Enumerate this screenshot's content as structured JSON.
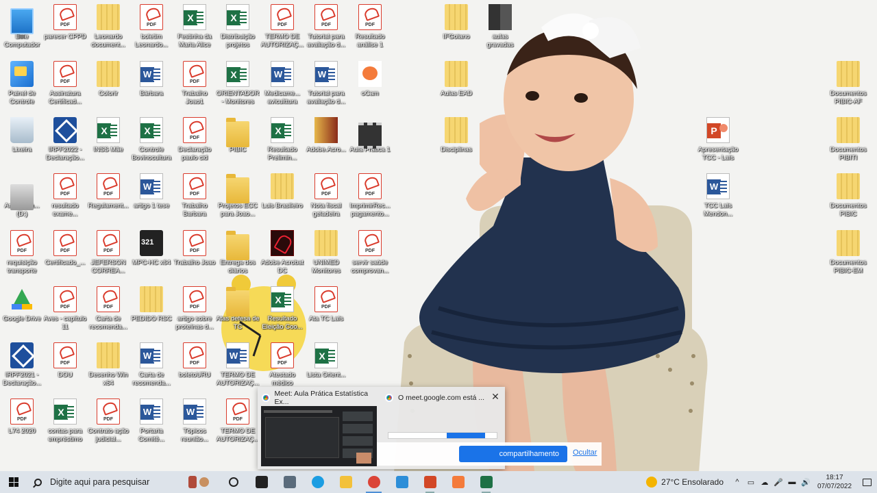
{
  "desktop": {
    "icons": [
      {
        "label": "Este Computador",
        "type": "pc"
      },
      {
        "label": "parecer CPPD",
        "type": "pdf"
      },
      {
        "label": "Leonardo document...",
        "type": "zip"
      },
      {
        "label": "boletim Leonardo...",
        "type": "pdf"
      },
      {
        "label": "Festinha da Maria Alice",
        "type": "xls"
      },
      {
        "label": "Distribuição projetos",
        "type": "xls"
      },
      {
        "label": "TERMO DE AUTORIZAÇ...",
        "type": "pdf"
      },
      {
        "label": "Tutorial para avaliação d...",
        "type": "pdf"
      },
      {
        "label": "Resultado análise 1",
        "type": "pdf"
      },
      {
        "label": "Painel de Controle",
        "type": "panel"
      },
      {
        "label": "Assinatura Certificad...",
        "type": "pdf"
      },
      {
        "label": "Colorir",
        "type": "zip"
      },
      {
        "label": "Bárbara",
        "type": "doc"
      },
      {
        "label": "Trabalho Joao1",
        "type": "pdf"
      },
      {
        "label": "ORIENTADOR - Monitores",
        "type": "xls"
      },
      {
        "label": "Medicame... aviculttura",
        "type": "doc"
      },
      {
        "label": "Tutorial para avaliação d...",
        "type": "doc"
      },
      {
        "label": "oCam",
        "type": "ocam"
      },
      {
        "label": "Lixeira",
        "type": "bin"
      },
      {
        "label": "IRPF2022 - Declaração...",
        "type": "irpf"
      },
      {
        "label": "INSS Mãe",
        "type": "xls"
      },
      {
        "label": "Controle Bovinocultura",
        "type": "xls"
      },
      {
        "label": "Declaração paulo cid",
        "type": "pdf"
      },
      {
        "label": "PIBIC",
        "type": "folder"
      },
      {
        "label": "Resultado Prelimin...",
        "type": "xls"
      },
      {
        "label": "Adobe.Acro...",
        "type": "door"
      },
      {
        "label": "Aula Prática 1",
        "type": "video"
      },
      {
        "label": "Armazena... (D:)",
        "type": "drive"
      },
      {
        "label": "resultado exame...",
        "type": "pdf"
      },
      {
        "label": "Regulament...",
        "type": "pdf"
      },
      {
        "label": "artigo 1 tese",
        "type": "doc"
      },
      {
        "label": "Trabalho Barbara",
        "type": "pdf"
      },
      {
        "label": "Projetos ECC para Joao...",
        "type": "folder"
      },
      {
        "label": "Luis Brasileiro",
        "type": "zip"
      },
      {
        "label": "Nota fiscal geladeira",
        "type": "pdf"
      },
      {
        "label": "ImprimirRec... pagamento...",
        "type": "pdf"
      },
      {
        "label": "requisição transporte",
        "type": "pdf"
      },
      {
        "label": "Certificado_...",
        "type": "pdf"
      },
      {
        "label": "JEFERSON CORREA...",
        "type": "pdf"
      },
      {
        "label": "MPC-HC x64",
        "type": "mpc"
      },
      {
        "label": "Trabalho Joao",
        "type": "pdf"
      },
      {
        "label": "Entrega dos diários",
        "type": "folder"
      },
      {
        "label": "Adobe Acrobat DC",
        "type": "acro"
      },
      {
        "label": "UNIMED Monitores",
        "type": "zip"
      },
      {
        "label": "servir saúde comprovan...",
        "type": "pdf"
      },
      {
        "label": "Google Drive",
        "type": "gdrive"
      },
      {
        "label": "Aves - capítulo 11",
        "type": "pdf"
      },
      {
        "label": "Carta de recomenda...",
        "type": "pdf"
      },
      {
        "label": "PEDIDO RSC",
        "type": "zip"
      },
      {
        "label": "artigo sobre proteínas d...",
        "type": "pdf"
      },
      {
        "label": "Atas defesa de TC",
        "type": "folder"
      },
      {
        "label": "Resultado Eleição Coo...",
        "type": "xls"
      },
      {
        "label": "Ata TC Laís",
        "type": "pdf"
      },
      {
        "label": "IRPF2021 - Declaração...",
        "type": "irpf"
      },
      {
        "label": "DOU",
        "type": "pdf"
      },
      {
        "label": "Desenho Win x64",
        "type": "zip"
      },
      {
        "label": "Carta de recomenda...",
        "type": "doc"
      },
      {
        "label": "boletoURU",
        "type": "pdf"
      },
      {
        "label": "TERMO DE AUTORIZAÇ...",
        "type": "doc"
      },
      {
        "label": "Atestado médico",
        "type": "pdf"
      },
      {
        "label": "Lista Orient...",
        "type": "xls"
      },
      {
        "label": "L74 2020",
        "type": "pdf"
      },
      {
        "label": "contas para empréstimo",
        "type": "xls"
      },
      {
        "label": "Contrato ação judicial...",
        "type": "pdf"
      },
      {
        "label": "Portaria Comitê...",
        "type": "doc"
      },
      {
        "label": "Tópicos reunião...",
        "type": "doc"
      },
      {
        "label": "TERMO DE AUTORIZAÇ...",
        "type": "pdf"
      },
      {
        "label": "IFGoiano",
        "type": "zip"
      },
      {
        "label": "aulas gravadas",
        "type": "books"
      },
      {
        "label": "Aulas EAD",
        "type": "zip"
      },
      {
        "label": "Disciplinas",
        "type": "zip"
      },
      {
        "label": "Documentos PIBIC-AF",
        "type": "zip"
      },
      {
        "label": "Documentos PIBITI",
        "type": "zip"
      },
      {
        "label": "Apresentação TCC - Laís",
        "type": "ppt"
      },
      {
        "label": "TCC Laís Mendon...",
        "type": "doc"
      },
      {
        "label": "Documentos PIBIC",
        "type": "zip"
      },
      {
        "label": "Documentos PIBIC-EM",
        "type": "zip"
      }
    ]
  },
  "thumbnail_popup": {
    "thumb1_title": "Meet: Aula Prática Estatística Ex...",
    "thumb2_title": "O meet.google.com está ...",
    "close_glyph": "✕"
  },
  "share_banner": {
    "stop_label": "compartilhamento",
    "hide_label": "Ocultar"
  },
  "taskbar": {
    "search_placeholder": "Digite aqui para pesquisar",
    "apps": [
      {
        "name": "cortana",
        "color": "#222222",
        "state": "none"
      },
      {
        "name": "task-view",
        "color": "#222222",
        "state": "none"
      },
      {
        "name": "calculator",
        "color": "#5a6b7b",
        "state": "none"
      },
      {
        "name": "edge",
        "color": "#1b9de2",
        "state": "none"
      },
      {
        "name": "file-explorer",
        "color": "#f3c13a",
        "state": "none"
      },
      {
        "name": "chrome",
        "color": "#db4437",
        "state": "active"
      },
      {
        "name": "vscode",
        "color": "#2d8ed8",
        "state": "none"
      },
      {
        "name": "powerpoint",
        "color": "#d24726",
        "state": "open"
      },
      {
        "name": "ocam",
        "color": "#f47b3b",
        "state": "none"
      },
      {
        "name": "excel",
        "color": "#1e7145",
        "state": "open"
      }
    ],
    "weather": "27°C  Ensolarado",
    "tray_glyphs": [
      "^",
      "▭",
      "☁",
      "🎤",
      "▬",
      "🔊"
    ],
    "time": "18:17",
    "date": "07/07/2022"
  }
}
